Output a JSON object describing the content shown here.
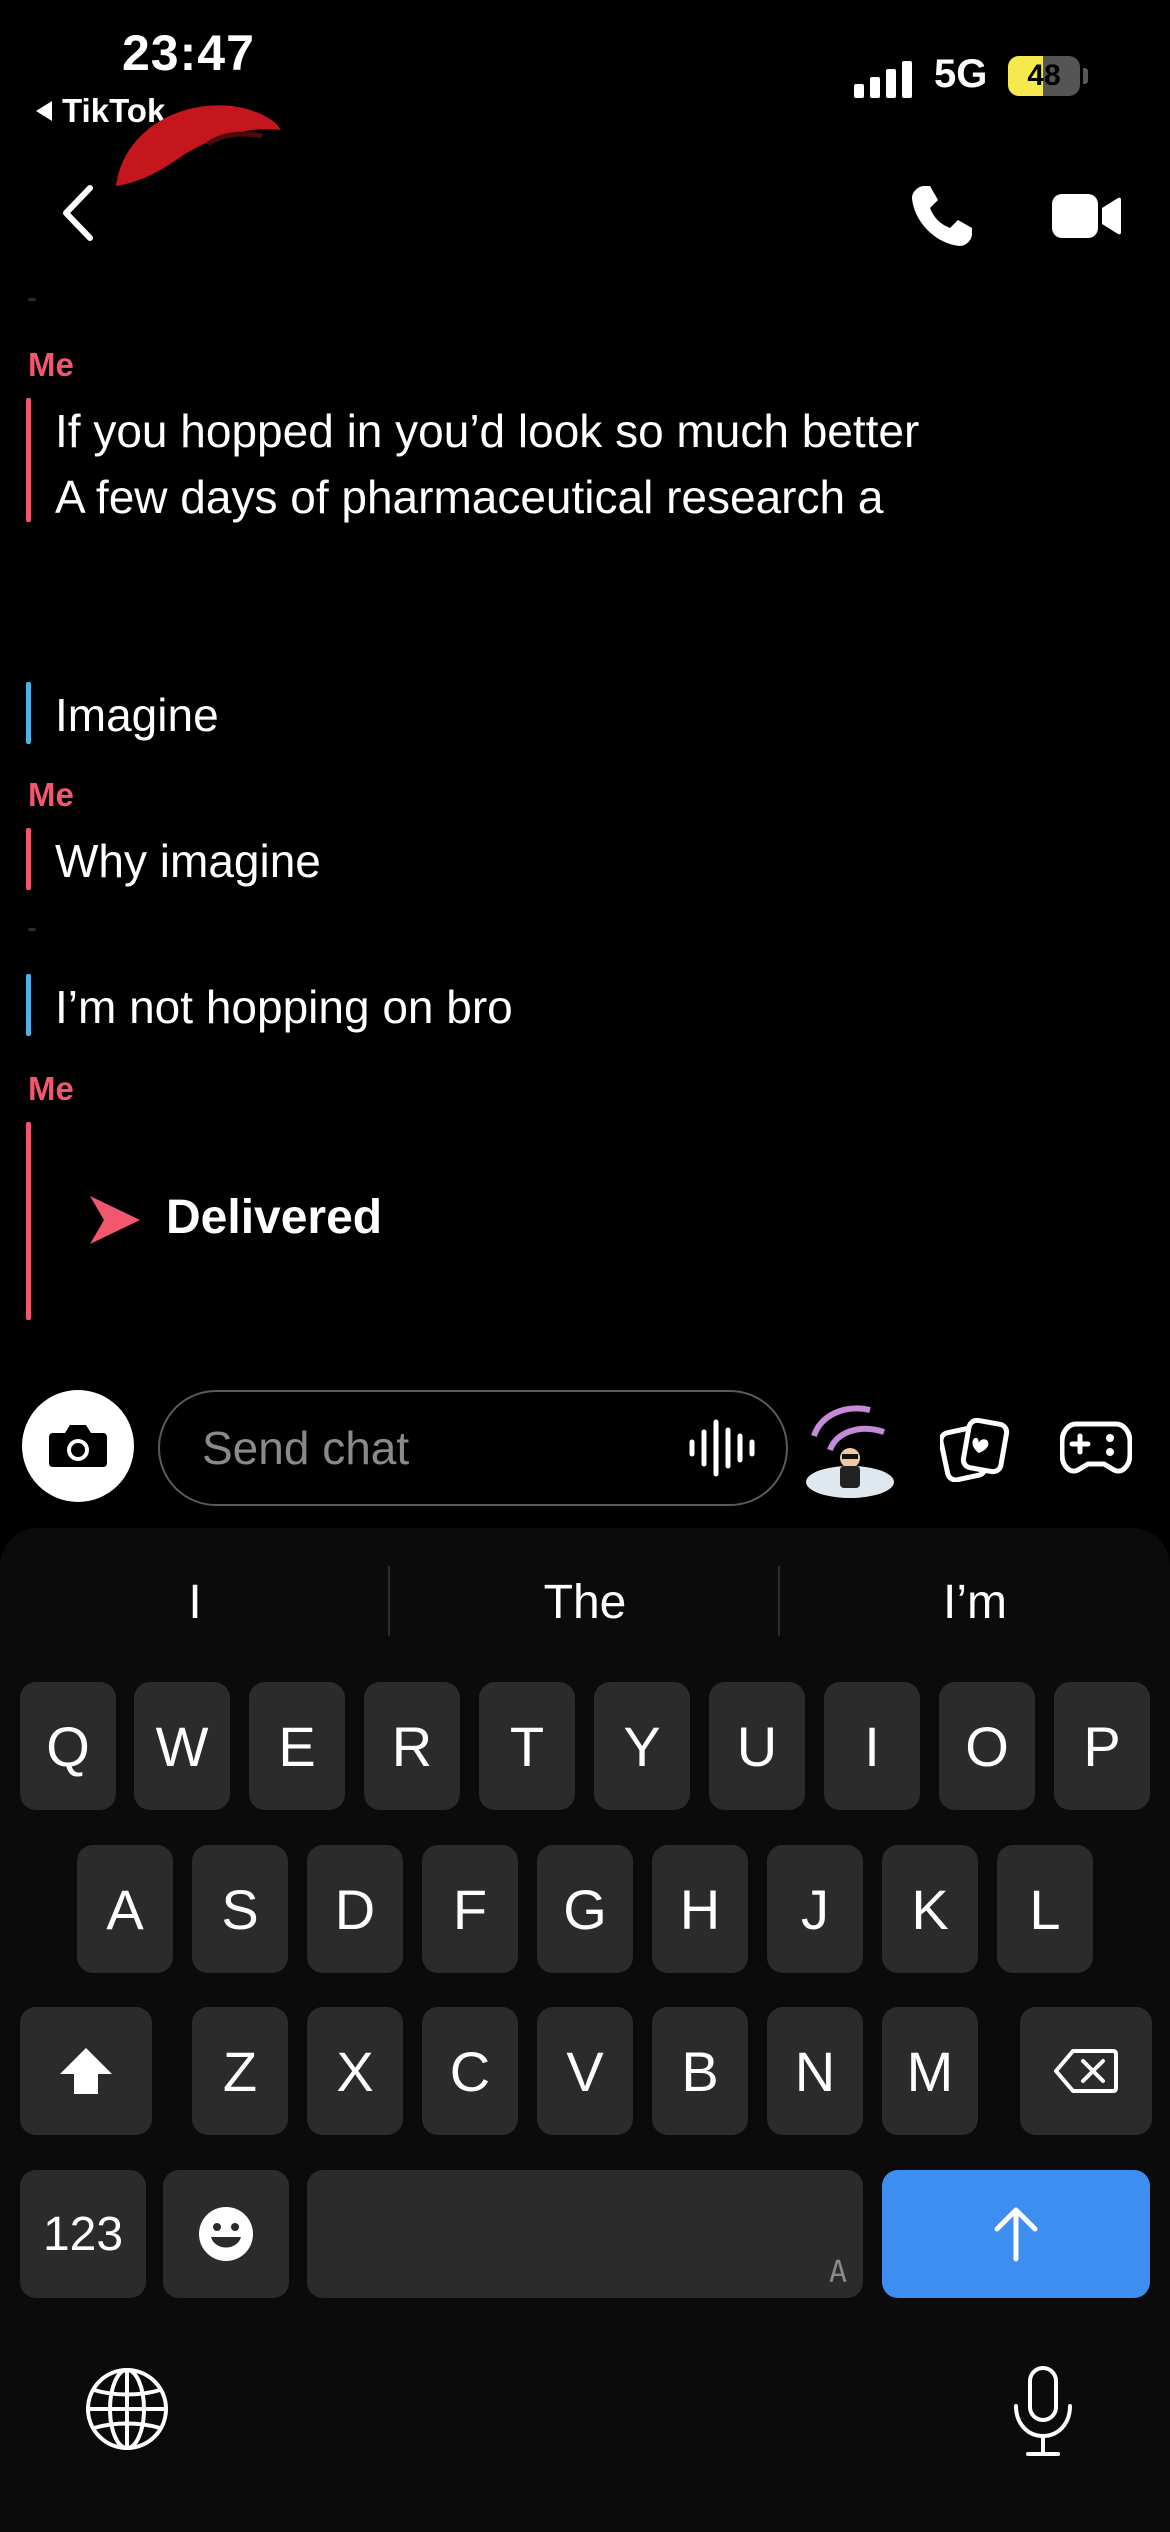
{
  "status_bar": {
    "time": "23:47",
    "back_app": "TikTok",
    "network": "5G",
    "battery": "48"
  },
  "messages": [
    {
      "sender": "Me",
      "lines": [
        "If you hopped in you’d look so much better",
        "A few days of pharmaceutical research a"
      ]
    },
    {
      "text": "Imagine"
    },
    {
      "sender": "Me",
      "text": "Why imagine"
    },
    {
      "text": "I’m not hopping on bro"
    },
    {
      "sender": "Me",
      "status": "Delivered"
    }
  ],
  "input": {
    "placeholder": "Send chat"
  },
  "predictions": [
    "I",
    "The",
    "I’m"
  ],
  "keyboard": {
    "row1": [
      "Q",
      "W",
      "E",
      "R",
      "T",
      "Y",
      "U",
      "I",
      "O",
      "P"
    ],
    "row2": [
      "A",
      "S",
      "D",
      "F",
      "G",
      "H",
      "J",
      "K",
      "L"
    ],
    "row3": [
      "Z",
      "X",
      "C",
      "V",
      "B",
      "N",
      "M"
    ],
    "numbers_label": "123",
    "space_hint": "A"
  },
  "colors": {
    "me": "#f2576f",
    "them": "#4fb3e8",
    "return_key": "#3d8ef0"
  },
  "icons": [
    "back-arrow-icon",
    "phone-icon",
    "video-camera-icon",
    "camera-icon",
    "voice-wave-icon",
    "cards-icon",
    "game-controller-icon",
    "shift-icon",
    "backspace-icon",
    "emoji-icon",
    "return-arrow-icon",
    "globe-icon",
    "microphone-icon",
    "delivered-arrow-icon"
  ]
}
